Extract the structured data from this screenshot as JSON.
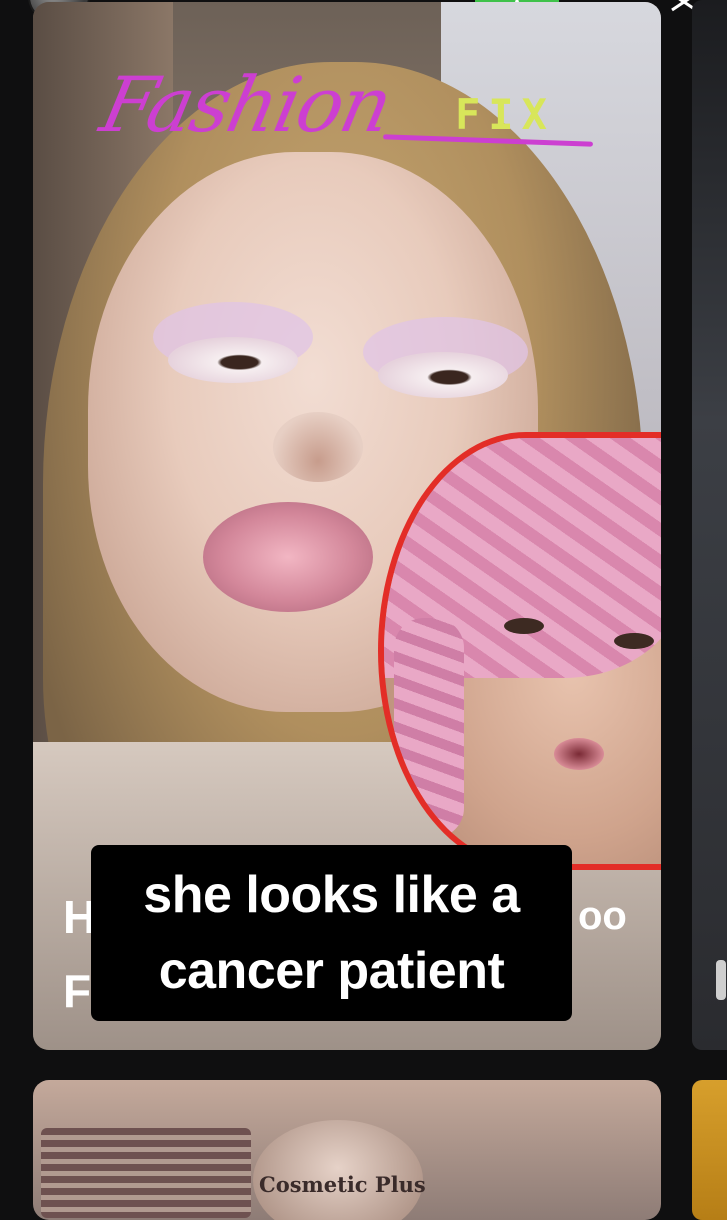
{
  "logo": {
    "script_text": "Fashion",
    "fix_text": "FIX"
  },
  "caption": {
    "line1": "she looks like a",
    "line2": "cancer patient"
  },
  "hidden_headline": {
    "line1_start": "H",
    "line2_start": "F",
    "line1_end": "oo"
  },
  "next_card": {
    "brand_text": "Cosmetic Plus"
  },
  "colors": {
    "caption_bg": "#000000",
    "caption_text": "#ffffff",
    "inset_ring": "#e32d27",
    "logo_pink": "#cc3fd1",
    "logo_yellow": "#d8e65a",
    "status_green": "#3fc24a"
  },
  "icons": [
    "close-icon",
    "star-icon"
  ]
}
